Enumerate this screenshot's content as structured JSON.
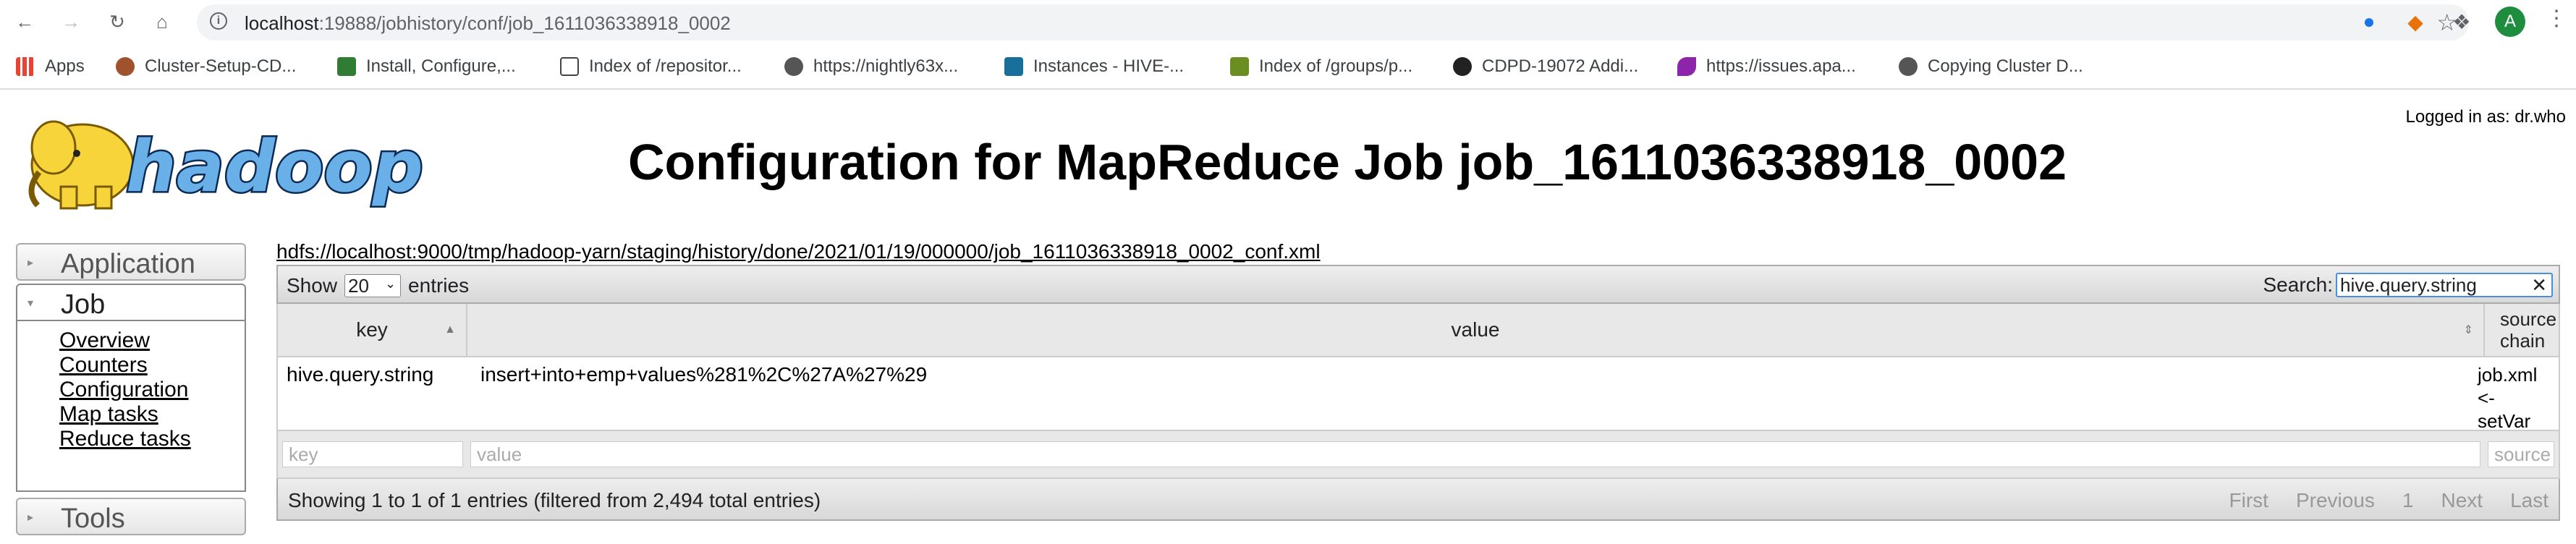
{
  "browser": {
    "url_host": "localhost",
    "url_path": ":19888/jobhistory/conf/job_1611036338918_0002",
    "avatar_letter": "A",
    "bookmarks": [
      {
        "label": "Apps",
        "color": "#ea4335"
      },
      {
        "label": "Cluster-Setup-CD...",
        "color": "#a0522d"
      },
      {
        "label": "Install, Configure,...",
        "color": "#2e7d32"
      },
      {
        "label": "Index of /repositor...",
        "color": "#444444"
      },
      {
        "label": "https://nightly63x...",
        "color": "#555555"
      },
      {
        "label": "Instances - HIVE-...",
        "color": "#1a6f9a"
      },
      {
        "label": "Index of /groups/p...",
        "color": "#6b8e23"
      },
      {
        "label": "CDPD-19072 Addi...",
        "color": "#222222"
      },
      {
        "label": "https://issues.apa...",
        "color": "#8e24aa"
      },
      {
        "label": "Copying Cluster D...",
        "color": "#555555"
      }
    ]
  },
  "page": {
    "logged_in": "Logged in as: dr.who",
    "title": "Configuration for MapReduce Job job_1611036338918_0002",
    "hdfs_link": "hdfs://localhost:9000/tmp/hadoop-yarn/staging/history/done/2021/01/19/000000/job_1611036338918_0002_conf.xml",
    "logo_text": "hadoop"
  },
  "nav": {
    "application": "Application",
    "job": "Job",
    "job_links": [
      "Overview",
      "Counters",
      "Configuration",
      "Map tasks",
      "Reduce tasks"
    ],
    "tools": "Tools"
  },
  "table": {
    "show_label": "Show",
    "entries_value": "20",
    "entries_label": "entries",
    "search_label": "Search:",
    "search_value": "hive.query.string",
    "columns": [
      "key",
      "value",
      "source chain"
    ],
    "rows": [
      {
        "key": "hive.query.string",
        "value": "insert+into+emp+values%281%2C%27A%27%29",
        "source": "job.xml <- setVar"
      }
    ],
    "filter_placeholders": [
      "key",
      "value",
      "source ch"
    ],
    "info": "Showing 1 to 1 of 1 entries (filtered from 2,494 total entries)",
    "pager": [
      "First",
      "Previous",
      "1",
      "Next",
      "Last"
    ]
  }
}
